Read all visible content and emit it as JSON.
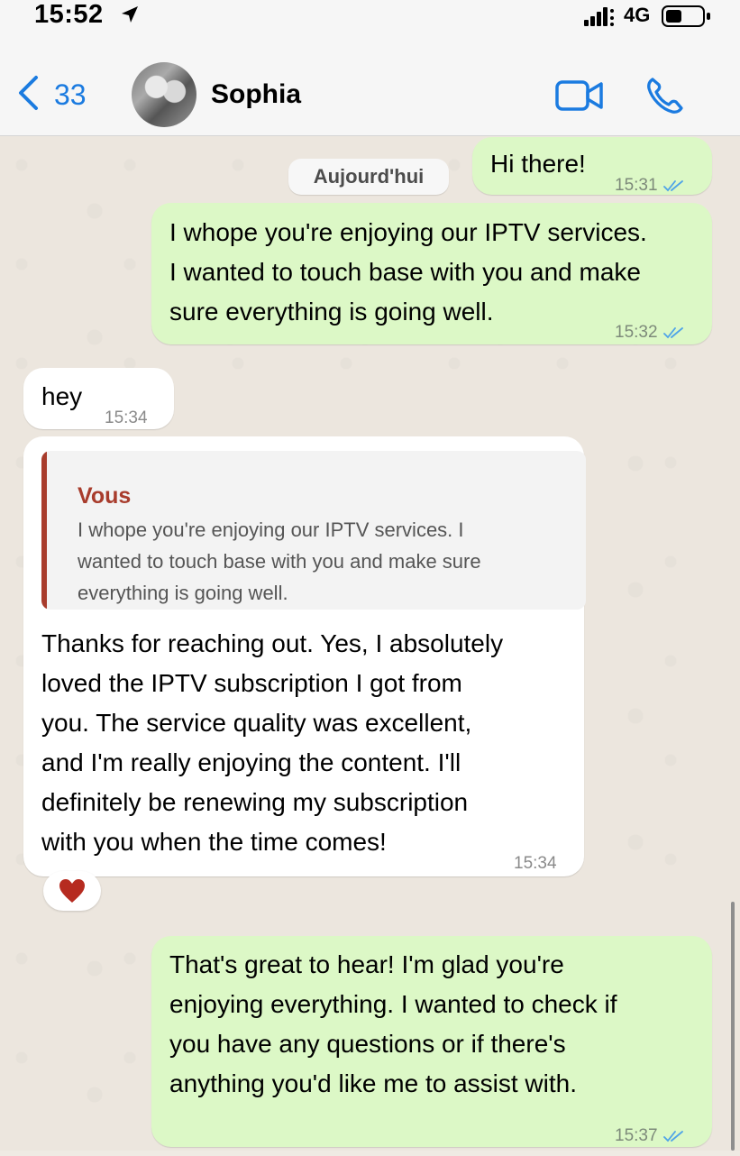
{
  "status_bar": {
    "time": "15:52",
    "network": "4G"
  },
  "header": {
    "back_count": "33",
    "contact_name": "Sophia"
  },
  "date_chip": "Aujourd'hui",
  "messages": [
    {
      "direction": "out",
      "text": "Hi there!",
      "time": "15:31"
    },
    {
      "direction": "out",
      "lines": [
        "I whope you're enjoying our IPTV services.",
        "I wanted to touch base with you and make",
        "sure everything is going well."
      ],
      "time": "15:32"
    },
    {
      "direction": "in",
      "text": "hey",
      "time": "15:34"
    },
    {
      "direction": "in",
      "quote": {
        "author": "Vous",
        "lines": [
          "I whope you're enjoying our IPTV services. I",
          "wanted to touch base with you and make sure",
          "everything is going well."
        ]
      },
      "lines": [
        "Thanks for reaching out. Yes, I absolutely",
        "loved the IPTV subscription I got from",
        "you. The service quality was excellent,",
        "and I'm really enjoying the content. I'll",
        "definitely be renewing my subscription",
        "with you when the time comes!"
      ],
      "time": "15:34",
      "reaction": "heart"
    },
    {
      "direction": "out",
      "lines": [
        "That's great to hear! I'm glad you're",
        "enjoying everything. I wanted to check if",
        "you have any questions or if there's",
        "anything you'd like me to assist with."
      ],
      "time": "15:37"
    }
  ],
  "colors": {
    "accent": "#1b7be0",
    "outgoing_bubble": "#dcf8c6",
    "incoming_bubble": "#ffffff",
    "quote_author": "#a83c2c",
    "read_ticks": "#4fa3e8"
  },
  "icons": [
    "location-arrow-icon",
    "signal-icon",
    "battery-icon",
    "chevron-left-icon",
    "video-camera-icon",
    "phone-icon",
    "double-check-icon",
    "heart-icon"
  ]
}
